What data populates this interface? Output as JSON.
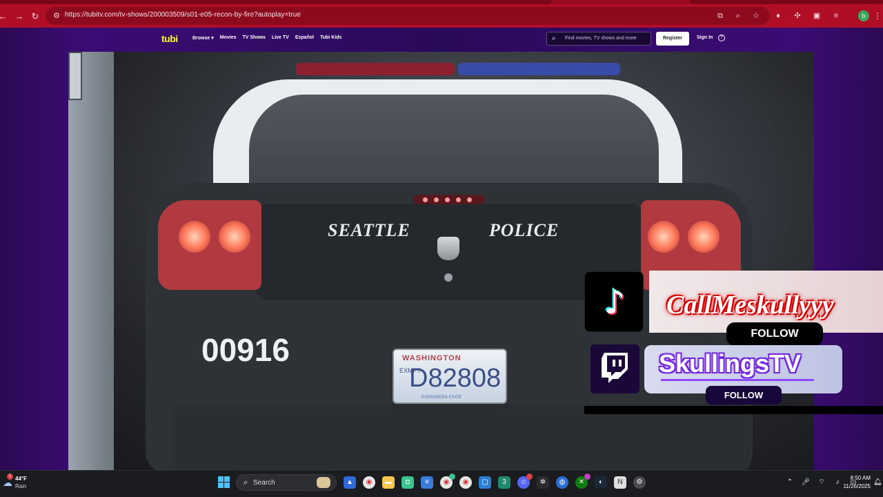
{
  "browser": {
    "url": "https://tubitv.com/tv-shows/200003509/s01-e05-recon-by-fire?autoplay=true",
    "profile_initial": "b"
  },
  "tubi": {
    "logo": "tubi",
    "nav": [
      "Browse ▾",
      "Movies",
      "TV Shows",
      "Live TV",
      "Español",
      "Tubi Kids"
    ],
    "search_placeholder": "Find movies, TV shows and more",
    "register_label": "Register",
    "signin_label": "Sign In",
    "help_glyph": "?"
  },
  "video_frame": {
    "car_text_left": "SEATTLE",
    "car_text_right": "POLICE",
    "car_number": "00916",
    "plate_state": "WASHINGTON",
    "plate_number": "D82808",
    "plate_side": "EXMPT",
    "plate_sub": "EVERGREEN STATE"
  },
  "overlay": {
    "tiktok_name": "CallMeskullyyy",
    "tiktok_follow": "FOLLOW",
    "twitch_name": "SkullingsTV",
    "twitch_follow": "FOLLOW"
  },
  "taskbar": {
    "weather_temp": "44°F",
    "weather_desc": "Rain",
    "weather_badge": "1",
    "search_label": "Search",
    "time": "8:50 AM",
    "date": "11/26/2025"
  },
  "colors": {
    "chrome": "#c8102e",
    "tubi_yellow": "#ffff13",
    "page_purple": "#3b0c74",
    "tiktok_red": "#e40000",
    "twitch_purple": "#9146ff"
  }
}
